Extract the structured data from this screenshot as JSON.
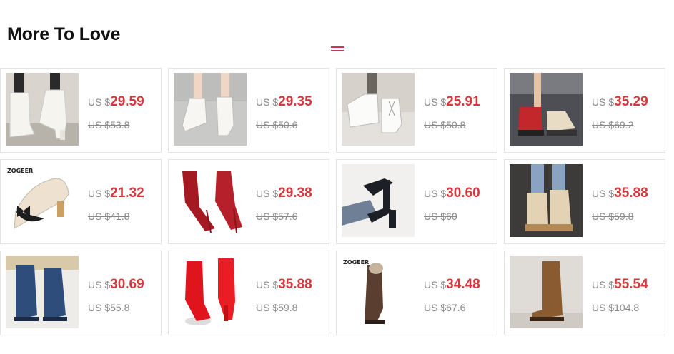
{
  "section": {
    "title": "More To Love",
    "divider_icon": "double-line-icon"
  },
  "currency_label": "US $",
  "colors": {
    "price": "#d9363e",
    "accent": "#c8375a",
    "muted": "#888888"
  },
  "products": [
    {
      "currency": "US $",
      "price": "29.59",
      "original": "US $53.8",
      "image": "white-heeled-ankle-boots"
    },
    {
      "currency": "US $",
      "price": "29.35",
      "original": "US $50.6",
      "image": "white-ankle-boots-on-floor"
    },
    {
      "currency": "US $",
      "price": "25.91",
      "original": "US $50.8",
      "image": "white-lace-up-ankle-boots"
    },
    {
      "currency": "US $",
      "price": "35.29",
      "original": "US $69.2",
      "image": "red-and-beige-combat-boots"
    },
    {
      "currency": "US $",
      "price": "21.32",
      "original": "US $41.8",
      "image": "beige-bow-pumps",
      "brand": "ZOGEER"
    },
    {
      "currency": "US $",
      "price": "29.38",
      "original": "US $57.6",
      "image": "red-patent-stiletto-boots"
    },
    {
      "currency": "US $",
      "price": "30.60",
      "original": "US $60",
      "image": "black-platform-sandals"
    },
    {
      "currency": "US $",
      "price": "35.88",
      "original": "US $59.8",
      "image": "beige-wedge-lace-up-boots"
    },
    {
      "currency": "US $",
      "price": "30.69",
      "original": "US $55.8",
      "image": "blue-knee-high-boots"
    },
    {
      "currency": "US $",
      "price": "35.88",
      "original": "US $59.8",
      "image": "red-patent-knee-boots"
    },
    {
      "currency": "US $",
      "price": "34.48",
      "original": "US $67.6",
      "image": "brown-suede-tall-boot",
      "brand": "ZOGEER"
    },
    {
      "currency": "US $",
      "price": "55.54",
      "original": "US $104.8",
      "image": "brown-leather-riding-boots"
    }
  ]
}
